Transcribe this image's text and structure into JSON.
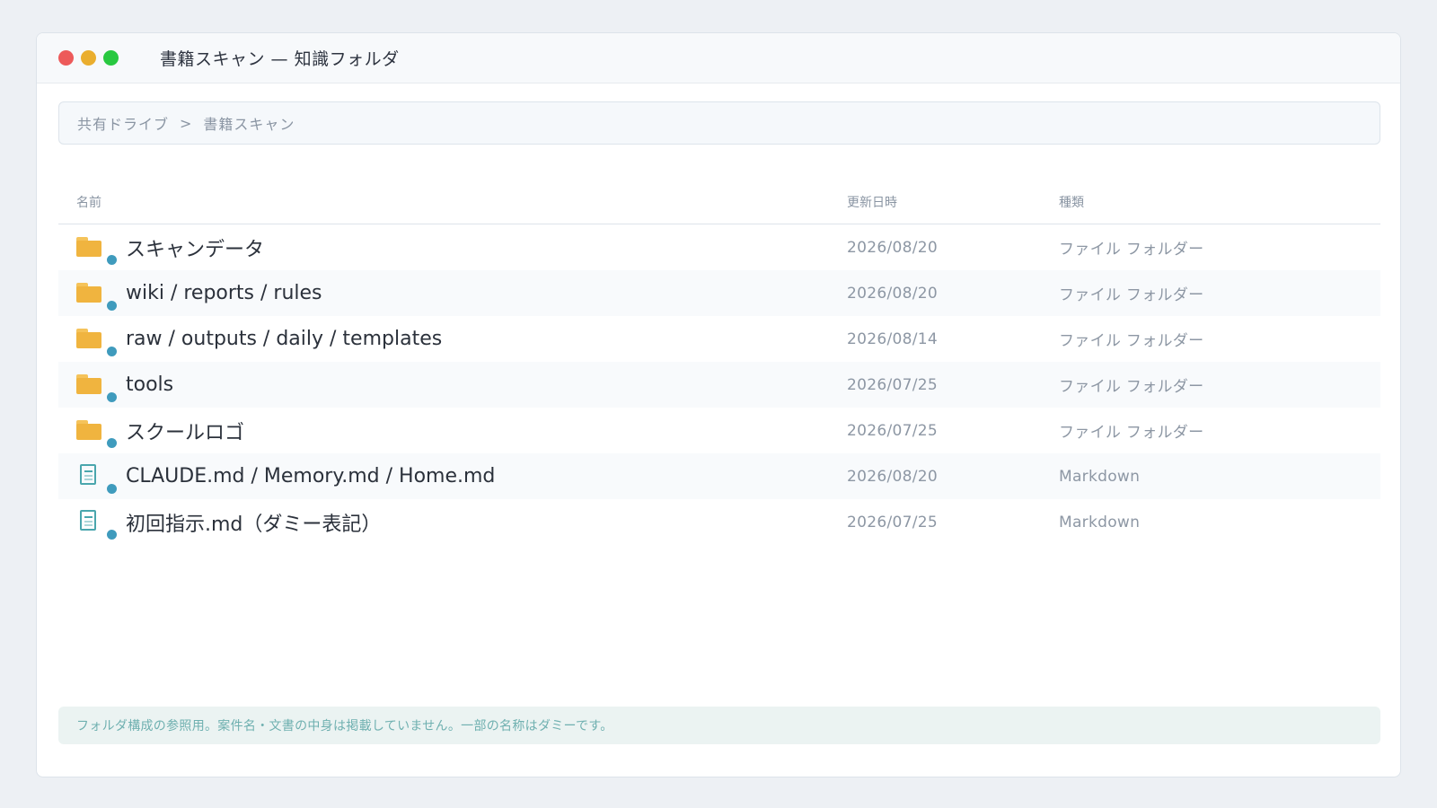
{
  "window": {
    "title": "書籍スキャン — 知識フォルダ",
    "controls": {
      "close_color": "#ed5a5a",
      "minimize_color": "#eaae2e",
      "maximize_color": "#28c840"
    }
  },
  "breadcrumb": {
    "items": [
      "共有ドライブ",
      "書籍スキャン"
    ],
    "separator": ">"
  },
  "table": {
    "headers": {
      "name": "名前",
      "date": "更新日時",
      "type": "種類"
    },
    "rows": [
      {
        "icon": "folder-icon",
        "name": "スキャンデータ",
        "date": "2026/08/20",
        "type": "ファイル フォルダー"
      },
      {
        "icon": "folder-icon",
        "name": "wiki / reports / rules",
        "date": "2026/08/20",
        "type": "ファイル フォルダー"
      },
      {
        "icon": "folder-icon",
        "name": "raw / outputs / daily / templates",
        "date": "2026/08/14",
        "type": "ファイル フォルダー"
      },
      {
        "icon": "folder-icon",
        "name": "tools",
        "date": "2026/07/25",
        "type": "ファイル フォルダー"
      },
      {
        "icon": "folder-icon",
        "name": "スクールロゴ",
        "date": "2026/07/25",
        "type": "ファイル フォルダー"
      },
      {
        "icon": "markdown-file-icon",
        "name": "CLAUDE.md  /  Memory.md  /  Home.md",
        "date": "2026/08/20",
        "type": "Markdown"
      },
      {
        "icon": "markdown-file-icon",
        "name": "初回指示.md（ダミー表記）",
        "date": "2026/07/25",
        "type": "Markdown"
      }
    ]
  },
  "footer": {
    "note": "フォルダ構成の参照用。案件名・文書の中身は掲載していません。一部の名称はダミーです。"
  },
  "colors": {
    "folder": "#f0b43f",
    "folder_tab": "#f5c35a",
    "doc": "#4aa6ad",
    "sync_badge": "#3f9bbd"
  }
}
